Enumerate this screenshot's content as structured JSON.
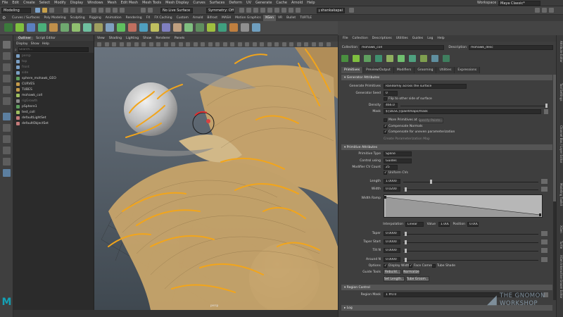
{
  "menubar": {
    "items": [
      "File",
      "Edit",
      "Create",
      "Select",
      "Modify",
      "Display",
      "Windows",
      "Mesh",
      "Edit Mesh",
      "Mesh Tools",
      "Mesh Display",
      "Curves",
      "Surfaces",
      "Deform",
      "UV",
      "Generate",
      "Cache",
      "Arnold",
      "Help"
    ],
    "workspace_label": "Workspace :",
    "workspace_value": "Maya Classic*"
  },
  "statusline": {
    "mode": "Modeling",
    "live_surface": "No Live Surface",
    "symmetry": "Symmetry: Off",
    "user": "shankakapai"
  },
  "shelf": {
    "tabs": [
      "Curves / Surfaces",
      "Poly Modeling",
      "Sculpting",
      "Rigging",
      "Animation",
      "Rendering",
      "FX",
      "FX Caching",
      "Custom",
      "Arnold",
      "Bifrost",
      "MASH",
      "Motion Graphics",
      "XGen",
      "VR",
      "Bullet",
      "TURTLE"
    ],
    "active_tab": "XGen"
  },
  "outliner": {
    "tabs": [
      "Outliner",
      "Script Editor"
    ],
    "menu": [
      "Display",
      "Show",
      "Help"
    ],
    "search_placeholder": "Search...",
    "items": [
      "persp",
      "top",
      "front",
      "side",
      "sphere_mohawk_GEO",
      "CURVES",
      "TUBES",
      "mohawk_coll",
      "rigGrowth",
      "pSphere1",
      "test_coll",
      "defaultLightSet",
      "defaultObjectSet"
    ]
  },
  "viewport": {
    "menu": [
      "View",
      "Shading",
      "Lighting",
      "Show",
      "Renderer",
      "Panels"
    ],
    "camera_label": "persp"
  },
  "xgen": {
    "menu": [
      "File",
      "Collection",
      "Descriptions",
      "Utilities",
      "Guides",
      "Log",
      "Help"
    ],
    "collection_label": "Collection",
    "collection_value": "mohawk_coll",
    "description_label": "Description",
    "description_value": "mohawk_desc",
    "tabs": [
      "Primitives",
      "Preview/Output",
      "Modifiers",
      "Grooming",
      "Utilities",
      "Expressions"
    ],
    "active_tab": "Primitives",
    "generator": {
      "header": "Generator Attributes",
      "primitives_label": "Generate Primitives",
      "primitives_value": "Randomly across the surface",
      "seed_label": "Generator Seed",
      "seed_value": "0",
      "flip_label": "Flip to other side of surface",
      "density_label": "Density",
      "density_value": "466.0",
      "mask_label": "Mask",
      "mask_value": "${DESC}/paintmaps/mask",
      "more_prims_label": "More Primitives at",
      "specify_points": "Specify Points...",
      "compensate_normals": "Compensate Normals",
      "compensate_uneven": "Compensate for uneven parameterization",
      "create_map": "Create Parameterization Map"
    },
    "primitive": {
      "header": "Primitive Attributes",
      "type_label": "Primitive Type",
      "type_value": "Spline",
      "control_label": "Control using",
      "control_value": "Guides",
      "cv_label": "Modifier CV Count",
      "cv_value": "25",
      "uniform_label": "Uniform CVs",
      "length_label": "Length",
      "length_value": "1.0000",
      "width_label": "Width",
      "width_value": "0.0200",
      "ramp_label": "Width Ramp",
      "interp_label": "Interpolation",
      "interp_value": "Linear",
      "value_label": "Value",
      "value_value": "1.000",
      "position_label": "Position",
      "position_value": "0.000",
      "taper_label": "Taper",
      "taper_value": "0.0000",
      "taper_start_label": "Taper Start",
      "taper_start_value": "0.0000",
      "tilt_label": "Tilt N",
      "tilt_value": "0.0000",
      "around_label": "Around N",
      "around_value": "0.0000",
      "options_label": "Options",
      "display_width": "Display Width",
      "face_camera": "Face Camera",
      "tube_shade": "Tube Shade",
      "guide_tools_label": "Guide Tools",
      "rebuild": "Rebuild...",
      "normalize": "Normalize",
      "set_length": "Set Length...",
      "tube_groom": "Tube Groom..."
    },
    "region": {
      "header": "Region Control",
      "mask_label": "Region Mask",
      "mask_value": "1 #0.0"
    },
    "log_header": "Log"
  },
  "right_strip": [
    "Attribute Editor",
    "Tool Settings",
    "Channel Box / Layer Editor",
    "Modeling Toolkit",
    "XGen",
    "Turtle",
    "XGen Interactive Groom Editor"
  ],
  "watermark": {
    "line1": "THE GNOMON",
    "line2": "WORKSHOP"
  },
  "colors": {
    "accent_blue": "#5285a6",
    "curve_orange": "#f2a51b",
    "hair": "#c9a56b"
  }
}
